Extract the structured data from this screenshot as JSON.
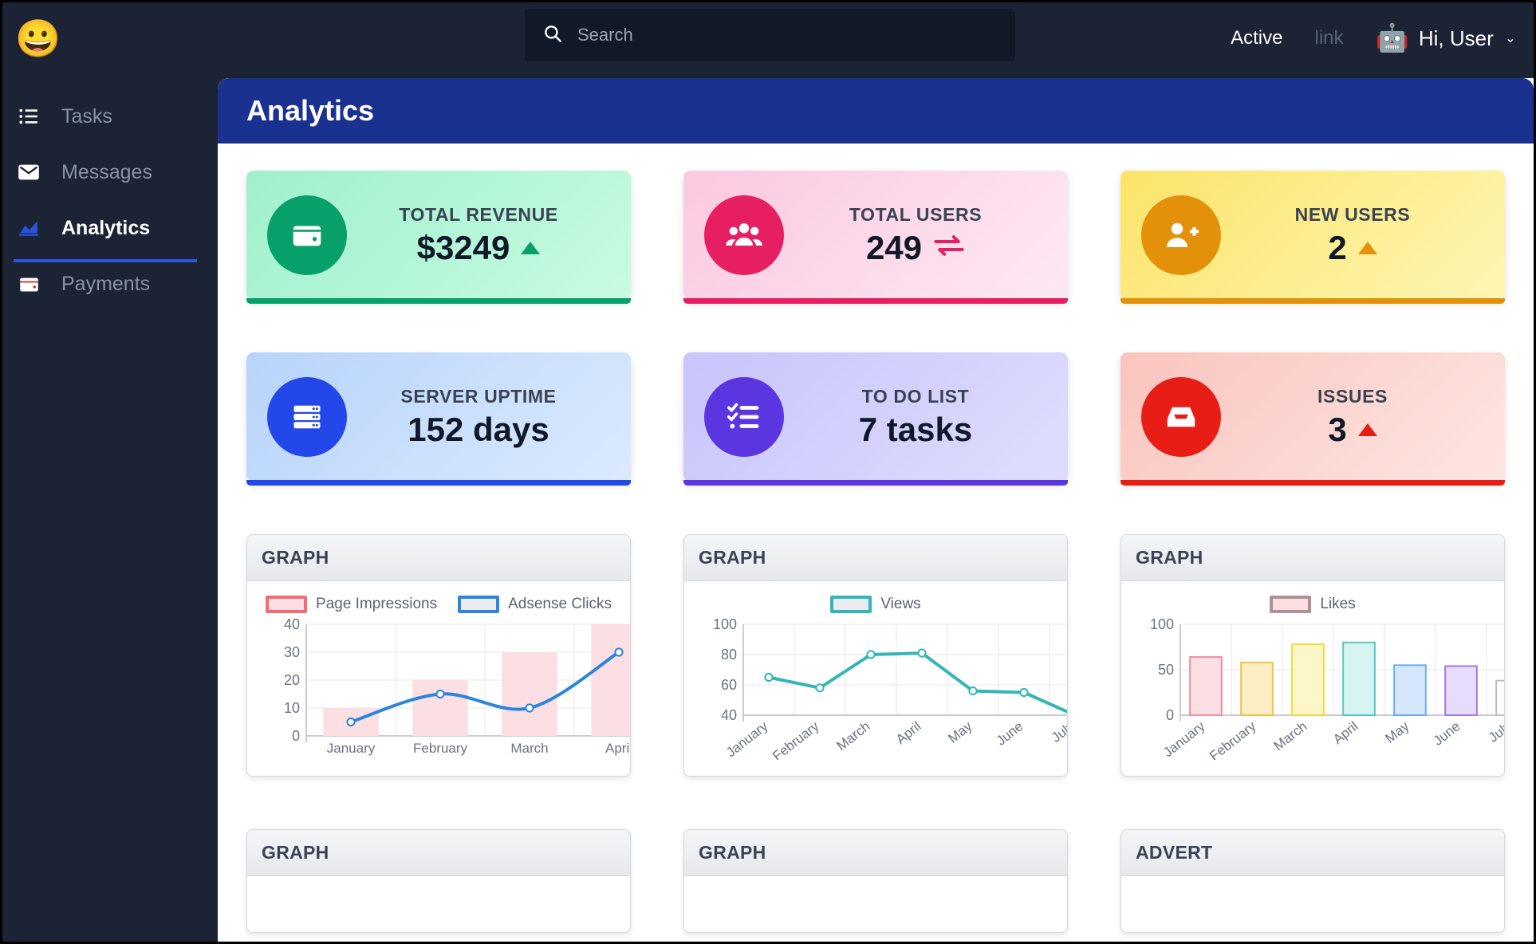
{
  "header": {
    "logo_icon": "grinning-face-emoji",
    "logo_glyph": "😀",
    "search": {
      "placeholder": "Search",
      "value": "",
      "icon": "search-icon"
    },
    "active_label": "Active",
    "link_label": "link",
    "avatar_icon": "robot-avatar",
    "avatar_glyph": "🤖",
    "user_label": "Hi, User",
    "caret_glyph": "⌄"
  },
  "sidebar": {
    "items": [
      {
        "label": "Tasks",
        "icon": "list-check-icon",
        "active": false
      },
      {
        "label": "Messages",
        "icon": "envelope-icon",
        "active": false
      },
      {
        "label": "Analytics",
        "icon": "chart-area-icon",
        "active": true
      },
      {
        "label": "Payments",
        "icon": "wallet-icon",
        "active": false
      }
    ]
  },
  "page": {
    "title": "Analytics",
    "banner_color": "#1b3190"
  },
  "stats": [
    {
      "label": "TOTAL REVENUE",
      "value": "$3249",
      "accent": "#08a06a",
      "icon": "wallet-icon",
      "trend": "up"
    },
    {
      "label": "TOTAL USERS",
      "value": "249",
      "accent": "#e61f63",
      "icon": "users-icon",
      "trend": "exchange"
    },
    {
      "label": "NEW USERS",
      "value": "2",
      "accent": "#e3900b",
      "icon": "user-plus-icon",
      "trend": "up"
    },
    {
      "label": "SERVER UPTIME",
      "value": "152 days",
      "accent": "#2347e8",
      "icon": "server-icon",
      "trend": "none"
    },
    {
      "label": "TO DO LIST",
      "value": "7 tasks",
      "accent": "#5b36e0",
      "icon": "tasks-list-icon",
      "trend": "none"
    },
    {
      "label": "ISSUES",
      "value": "3",
      "accent": "#e81d16",
      "icon": "inbox-icon",
      "trend": "up"
    }
  ],
  "panels": {
    "row1": [
      {
        "title": "GRAPH"
      },
      {
        "title": "GRAPH"
      },
      {
        "title": "GRAPH"
      }
    ],
    "row2": [
      {
        "title": "GRAPH"
      },
      {
        "title": "GRAPH"
      },
      {
        "title": "ADVERT"
      }
    ]
  },
  "chart_data": [
    {
      "id": "impressions-clicks",
      "type": "bar",
      "title": "",
      "xlabel": "",
      "ylabel": "",
      "categories": [
        "January",
        "February",
        "March",
        "April"
      ],
      "ylim": [
        0,
        40
      ],
      "yticks": [
        0,
        10,
        20,
        30,
        40
      ],
      "grid": true,
      "legend_position": "top",
      "series": [
        {
          "name": "Page Impressions",
          "kind": "bar",
          "values": [
            10,
            20,
            30,
            40
          ],
          "fill": "#fbdfe2",
          "stroke": "#f26b77"
        },
        {
          "name": "Adsense Clicks",
          "kind": "line",
          "values": [
            5,
            15,
            10,
            30
          ],
          "fill": "#e9edf2",
          "stroke": "#2b85db"
        }
      ]
    },
    {
      "id": "views",
      "type": "line",
      "title": "",
      "xlabel": "",
      "ylabel": "",
      "categories": [
        "January",
        "February",
        "March",
        "April",
        "May",
        "June",
        "July"
      ],
      "ylim": [
        40,
        100
      ],
      "yticks": [
        40,
        60,
        80,
        100
      ],
      "grid": true,
      "legend_position": "top",
      "series": [
        {
          "name": "Views",
          "kind": "line",
          "values": [
            65,
            58,
            80,
            81,
            56,
            55,
            40
          ],
          "fill": "#e9edf2",
          "stroke": "#34b5b8"
        }
      ]
    },
    {
      "id": "likes",
      "type": "bar",
      "title": "",
      "xlabel": "",
      "ylabel": "",
      "categories": [
        "January",
        "February",
        "March",
        "April",
        "May",
        "June",
        "July"
      ],
      "ylim": [
        0,
        100
      ],
      "yticks": [
        0,
        50,
        100
      ],
      "grid": true,
      "legend_position": "top",
      "series": [
        {
          "name": "Likes",
          "kind": "bar",
          "values": [
            64,
            58,
            78,
            80,
            55,
            54,
            38
          ],
          "fill": "#fbdfe2",
          "stroke": "#8a8a8a",
          "bar_fills": [
            "#fbdfe2",
            "#fdeec4",
            "#fdf6c8",
            "#d5f4f2",
            "#d4e7fb",
            "#e7dcfb",
            "#ffffff"
          ],
          "bar_strokes": [
            "#f18fa0",
            "#f3c148",
            "#f2d83e",
            "#54c9c4",
            "#6aaef0",
            "#a47ae8",
            "#b9bcc2"
          ]
        }
      ]
    }
  ]
}
